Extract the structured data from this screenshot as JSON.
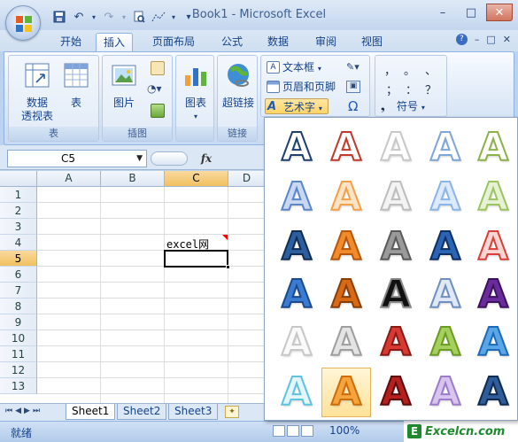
{
  "app": {
    "title": "Book1 - Microsoft Excel"
  },
  "qat": {
    "icons": [
      "save-icon",
      "undo-icon",
      "redo-icon",
      "print-preview-icon",
      "customize-icon"
    ]
  },
  "window_buttons": [
    "–",
    "□",
    "✕"
  ],
  "tabs": [
    {
      "label": "开始"
    },
    {
      "label": "插入",
      "active": true
    },
    {
      "label": "页面布局"
    },
    {
      "label": "公式"
    },
    {
      "label": "数据"
    },
    {
      "label": "审阅"
    },
    {
      "label": "视图"
    }
  ],
  "ribbon": {
    "table_group": {
      "label": "表",
      "pivot": "数据\n透视表",
      "table": "表"
    },
    "illustration_group": {
      "label": "插图",
      "picture": "图片"
    },
    "chart_group": {
      "chart": "图表"
    },
    "link_group": {
      "label": "链接",
      "hyperlink": "超链接"
    },
    "text_group": {
      "textbox": "文本框",
      "header_footer": "页眉和页脚",
      "wordart": "艺术字",
      "omega": "Ω"
    },
    "special_symbols": {
      "symbols": [
        "，",
        "。",
        "、",
        "；",
        "：",
        "？"
      ],
      "symbol_button": "符号"
    }
  },
  "formula_bar": {
    "name_box": "C5",
    "fx": "fx"
  },
  "sheet": {
    "columns": [
      "A",
      "B",
      "C",
      "D"
    ],
    "rows": [
      "1",
      "2",
      "3",
      "4",
      "5",
      "6",
      "7",
      "8",
      "9",
      "10",
      "11",
      "12",
      "13"
    ],
    "selected_column": "C",
    "selected_row": "5",
    "cell_c4": "excel网"
  },
  "sheet_tabs": [
    {
      "label": "Sheet1",
      "active": true
    },
    {
      "label": "Sheet2"
    },
    {
      "label": "Sheet3"
    }
  ],
  "status": {
    "ready": "就绪",
    "zoom": "100%"
  },
  "watermark": {
    "icon_letter": "E",
    "text": "Excelcn.com"
  },
  "wordart_gallery": {
    "glyph": "A",
    "selected_index": 26,
    "styles": [
      {
        "fill": "#ffffff",
        "stroke": "#1f3f6e"
      },
      {
        "fill": "#ffffff",
        "stroke": "#c0392b"
      },
      {
        "fill": "#ffffff",
        "stroke": "#c8c8c8"
      },
      {
        "fill": "#ffffff",
        "stroke": "#7ea6d6"
      },
      {
        "fill": "#ffffff",
        "stroke": "#8bb34a"
      },
      {
        "fill": "#c9d8f1",
        "stroke": "#5b86c9"
      },
      {
        "fill": "#fbe3c6",
        "stroke": "#f2a148"
      },
      {
        "fill": "#f3f3f3",
        "stroke": "#bdbdbd"
      },
      {
        "fill": "#dceafb",
        "stroke": "#8bb5e6"
      },
      {
        "fill": "#e6f2d3",
        "stroke": "#9cc561"
      },
      {
        "fill": "#2d5f9e",
        "stroke": "#0f2c55"
      },
      {
        "fill": "#f28b2b",
        "stroke": "#b5560c"
      },
      {
        "fill": "#9a9a9a",
        "stroke": "#5a5a5a"
      },
      {
        "fill": "#2b63b5",
        "stroke": "#0d2f63"
      },
      {
        "fill": "#f7d6d4",
        "stroke": "#d9403a"
      },
      {
        "fill": "#3b7bd1",
        "stroke": "#1a4a8e"
      },
      {
        "fill": "#d86a16",
        "stroke": "#8a3d05"
      },
      {
        "fill": "#111111",
        "stroke": "#888888"
      },
      {
        "fill": "#dfe8f5",
        "stroke": "#6e8fbf"
      },
      {
        "fill": "#6a2c9a",
        "stroke": "#3d1160"
      },
      {
        "fill": "#fafafa",
        "stroke": "#c7c7c7"
      },
      {
        "fill": "#e4e4e4",
        "stroke": "#9e9e9e"
      },
      {
        "fill": "#d63a33",
        "stroke": "#8c1814"
      },
      {
        "fill": "#a6d05e",
        "stroke": "#6a9b22"
      },
      {
        "fill": "#5aa7e8",
        "stroke": "#1d6bb8"
      },
      {
        "fill": "#e4f6fb",
        "stroke": "#5ec3e0"
      },
      {
        "fill": "#f6a43e",
        "stroke": "#cc6d0b"
      },
      {
        "fill": "#b41f1f",
        "stroke": "#5e0a0a"
      },
      {
        "fill": "#d8c4ee",
        "stroke": "#9b7cc9"
      },
      {
        "fill": "#2f5d99",
        "stroke": "#0f2b52"
      }
    ]
  }
}
